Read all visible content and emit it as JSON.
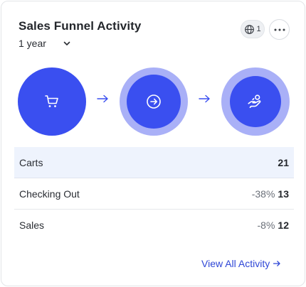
{
  "card": {
    "title": "Sales Funnel Activity",
    "range": {
      "selected": "1 year"
    },
    "globe_count": "1",
    "stages": [
      {
        "name": "Carts",
        "icon": "shopping-cart-icon"
      },
      {
        "name": "Checking Out",
        "icon": "arrow-right-circle-icon"
      },
      {
        "name": "Sales",
        "icon": "hand-coin-icon"
      }
    ],
    "rows": [
      {
        "label": "Carts",
        "pct": "",
        "value": "21"
      },
      {
        "label": "Checking Out",
        "pct": "-38%",
        "value": "13"
      },
      {
        "label": "Sales",
        "pct": "-8%",
        "value": "12"
      }
    ],
    "view_all_label": "View All Activity",
    "colors": {
      "accent": "#3a4ff0",
      "ring": "#a9b0f7",
      "link": "#2e46d6",
      "row_highlight": "#eef3fd"
    }
  }
}
